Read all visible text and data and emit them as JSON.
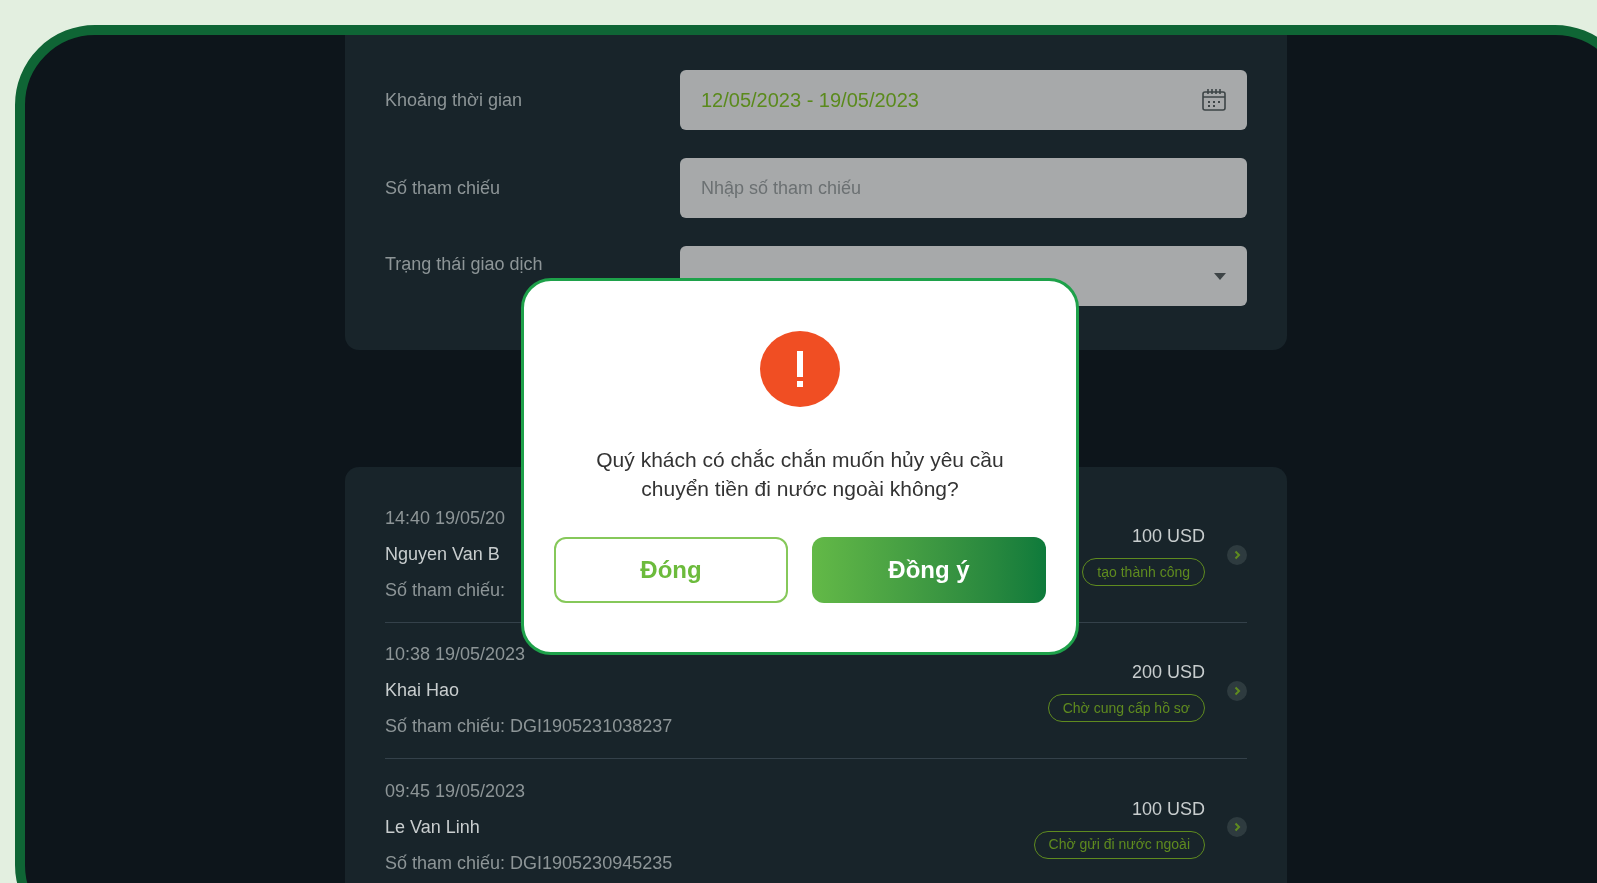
{
  "filters": [
    {
      "label": "Khoảng thời gian",
      "kind": "date",
      "value": "12/05/2023 - 19/05/2023"
    },
    {
      "label": "Số tham chiếu",
      "kind": "text",
      "placeholder": "Nhập số tham chiếu"
    },
    {
      "label": "Trạng thái giao dịch",
      "kind": "select"
    }
  ],
  "transactions": [
    {
      "time": "14:40 19/05/20",
      "name": "Nguyen Van B",
      "reference": "Số tham chiếu:",
      "amount": "100 USD",
      "status": "tạo thành công"
    },
    {
      "time": "10:38 19/05/2023",
      "name": "Khai Hao",
      "reference": "Số tham chiếu: DGI1905231038237",
      "amount": "200 USD",
      "status": "Chờ cung cấp hồ sơ"
    },
    {
      "time": "09:45 19/05/2023",
      "name": "Le Van Linh",
      "reference": "Số tham chiếu: DGI1905230945235",
      "amount": "100 USD",
      "status": "Chờ gửi đi nước ngoài"
    }
  ],
  "dialog": {
    "message": "Quý khách có chắc chắn muốn hủy yêu cầu chuyển tiền đi nước ngoài không?",
    "buttons": [
      {
        "label": "Đóng",
        "kind": "secondary"
      },
      {
        "label": "Đồng ý",
        "kind": "primary"
      }
    ]
  }
}
